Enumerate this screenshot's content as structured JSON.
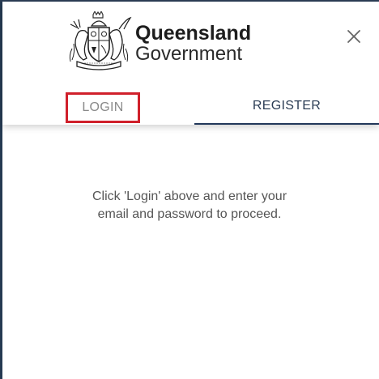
{
  "brand": {
    "line1": "Queensland",
    "line2": "Government"
  },
  "tabs": [
    {
      "label": "LOGIN",
      "highlighted": true
    },
    {
      "label": "REGISTER",
      "selected": true
    }
  ],
  "message": {
    "line1": "Click 'Login' above and enter your",
    "line2": "email and password to proceed."
  },
  "colors": {
    "accent": "#22385a",
    "highlight_border": "#d0202b",
    "text_muted": "#555555"
  },
  "icons": {
    "logo": "queensland-crest-icon",
    "close": "close-icon"
  }
}
